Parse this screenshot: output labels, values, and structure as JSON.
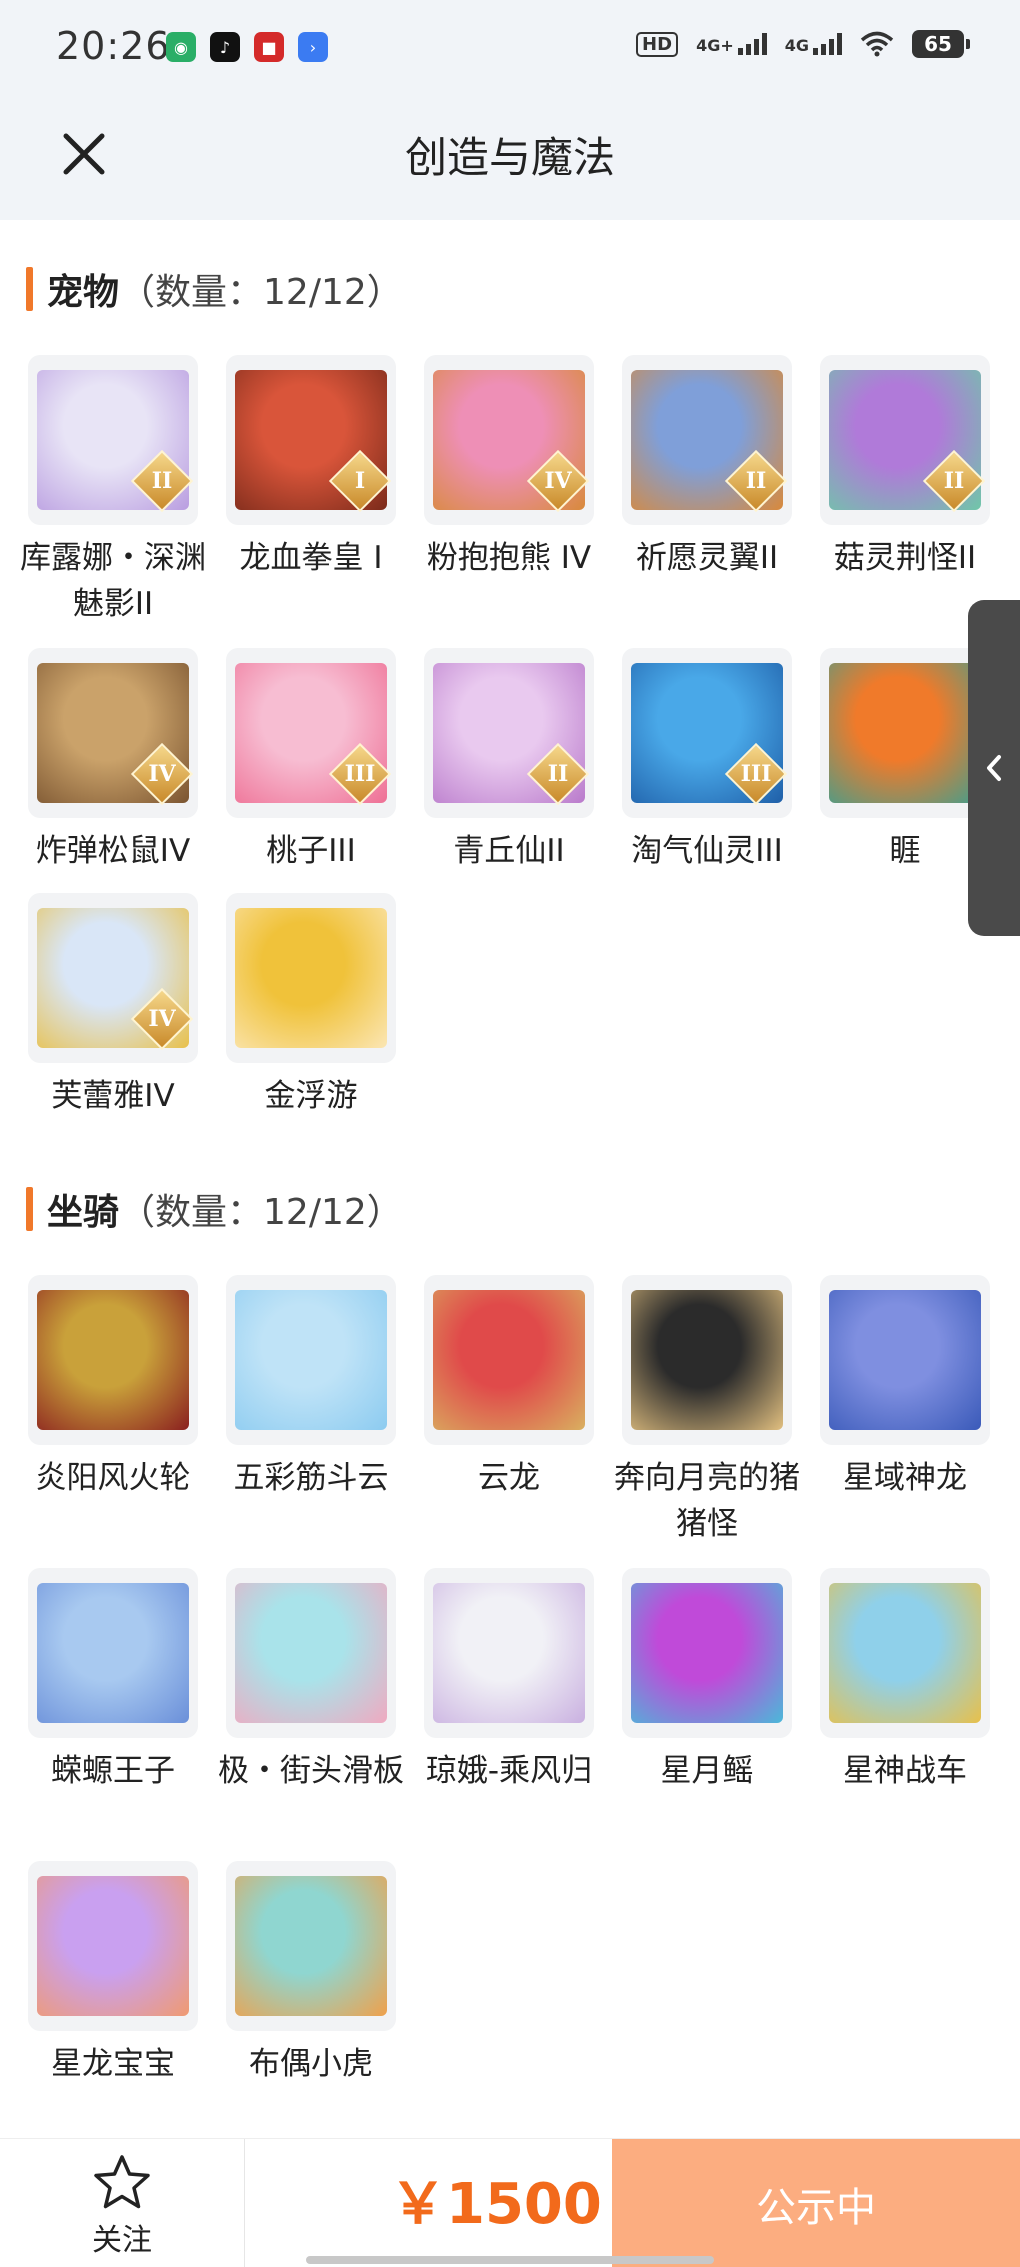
{
  "status_bar": {
    "time": "20:26",
    "apps": [
      {
        "icon": "wechat-icon",
        "color": "#2aae67"
      },
      {
        "icon": "tiktok-icon",
        "color": "#111111"
      },
      {
        "icon": "red-app-icon",
        "color": "#d42a2a"
      },
      {
        "icon": "arrow-app-icon",
        "color": "#3b7bf2"
      }
    ],
    "hd": "HD",
    "net1": "4G+",
    "net2": "4G",
    "battery": "65"
  },
  "header": {
    "title": "创造与魔法",
    "close_icon": "close-icon"
  },
  "sections": [
    {
      "name": "宠物",
      "count": "（数量：12/12）",
      "items": [
        {
          "label": "库露娜・深渊魅影II",
          "grade": "II",
          "colors": [
            "#e8e4f6",
            "#b99de0"
          ]
        },
        {
          "label": "龙血拳皇 I",
          "grade": "I",
          "colors": [
            "#d9553a",
            "#7a2a1a"
          ]
        },
        {
          "label": "粉抱抱熊 IV",
          "grade": "IV",
          "colors": [
            "#ee8fb6",
            "#d88a3a"
          ]
        },
        {
          "label": "祈愿灵翼II",
          "grade": "II",
          "colors": [
            "#7f9fd9",
            "#d9893a"
          ]
        },
        {
          "label": "菇灵荆怪II",
          "grade": "II",
          "colors": [
            "#b07ad9",
            "#6fc7a8"
          ]
        },
        {
          "label": "炸弹松鼠IV",
          "grade": "IV",
          "colors": [
            "#caa26a",
            "#7a5430"
          ]
        },
        {
          "label": "桃子III",
          "grade": "III",
          "colors": [
            "#f7bdd2",
            "#ee6f94"
          ]
        },
        {
          "label": "青丘仙II",
          "grade": "II",
          "colors": [
            "#e9c9ef",
            "#b97acb"
          ]
        },
        {
          "label": "淘气仙灵III",
          "grade": "III",
          "colors": [
            "#49a8e8",
            "#1f5fa8"
          ]
        },
        {
          "label": "睚",
          "grade": "",
          "colors": [
            "#f07a2a",
            "#3f9f8f"
          ]
        },
        {
          "label": "芙蕾雅IV",
          "grade": "IV",
          "colors": [
            "#d9e6f7",
            "#e8c04a"
          ]
        },
        {
          "label": "金浮游",
          "grade": "",
          "colors": [
            "#f0c23a",
            "#fbe6b4"
          ]
        }
      ]
    },
    {
      "name": "坐骑",
      "count": "（数量：12/12）",
      "items": [
        {
          "label": "炎阳风火轮",
          "grade": "",
          "colors": [
            "#c9a13a",
            "#8a1f1f"
          ]
        },
        {
          "label": "五彩筋斗云",
          "grade": "",
          "colors": [
            "#bfe3f7",
            "#8ccbf0"
          ]
        },
        {
          "label": "云龙",
          "grade": "",
          "colors": [
            "#e04a4a",
            "#d9b060"
          ]
        },
        {
          "label": "奔向月亮的猪猪怪",
          "grade": "",
          "colors": [
            "#2b2b2b",
            "#e2c080"
          ]
        },
        {
          "label": "星域神龙",
          "grade": "",
          "colors": [
            "#7f8fe0",
            "#3a5ab9"
          ]
        },
        {
          "label": "蝾螈王子",
          "grade": "",
          "colors": [
            "#a8c9f0",
            "#6a8fd9"
          ]
        },
        {
          "label": "极・街头滑板",
          "grade": "",
          "colors": [
            "#a9e3ea",
            "#f0a9c0"
          ]
        },
        {
          "label": "琼娥-乘风归",
          "grade": "",
          "colors": [
            "#f1f1f6",
            "#c9b0e0"
          ]
        },
        {
          "label": "星月鳐",
          "grade": "",
          "colors": [
            "#c04ad9",
            "#4ab9d9"
          ]
        },
        {
          "label": "星神战车",
          "grade": "",
          "colors": [
            "#8fd0ea",
            "#e8c04a"
          ]
        },
        {
          "label": "星龙宝宝",
          "grade": "",
          "colors": [
            "#c9a0f0",
            "#f09a70"
          ]
        },
        {
          "label": "布偶小虎",
          "grade": "",
          "colors": [
            "#8fd6d0",
            "#f0a04a"
          ]
        }
      ]
    }
  ],
  "side_tab": {
    "icon": "chevron-left-icon"
  },
  "bottom_bar": {
    "follow_label": "关注",
    "price": "￥1500",
    "status_button": "公示中"
  },
  "colors": {
    "accent": "#f0782a",
    "price": "#f26a1b",
    "status_button_bg": "#fcad80",
    "header_bg": "#f1f4f8"
  }
}
